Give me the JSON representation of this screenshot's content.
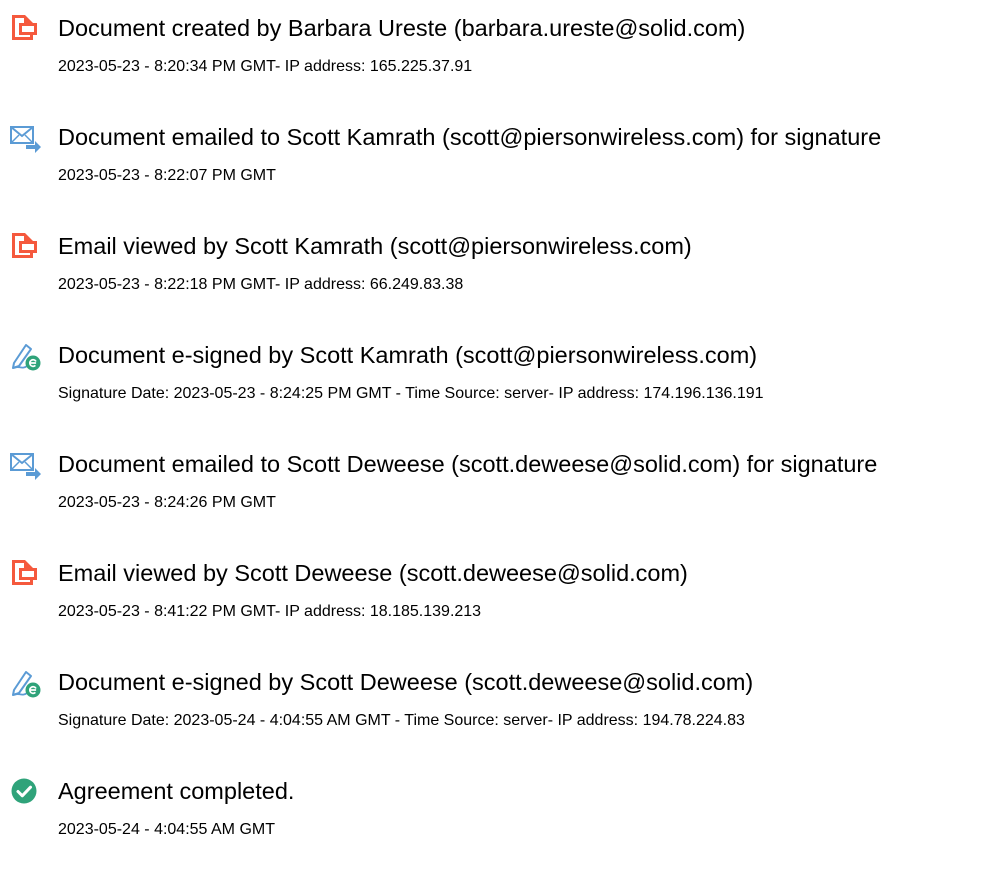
{
  "colors": {
    "document_icon": "#F5593D",
    "email_icon": "#5B9BD5",
    "esign_icon": "#2FA37A",
    "complete_icon": "#2FA37A"
  },
  "events": [
    {
      "icon": "document-icon",
      "title": "Document created by Barbara Ureste (barbara.ureste@solid.com)",
      "detail": "2023-05-23 - 8:20:34 PM GMT- IP address: 165.225.37.91"
    },
    {
      "icon": "email-sent-icon",
      "title": "Document emailed to Scott Kamrath (scott@piersonwireless.com) for signature",
      "detail": "2023-05-23 - 8:22:07 PM GMT"
    },
    {
      "icon": "document-icon",
      "title": "Email viewed by Scott Kamrath (scott@piersonwireless.com)",
      "detail": "2023-05-23 - 8:22:18 PM GMT- IP address: 66.249.83.38"
    },
    {
      "icon": "esign-pen-icon",
      "title": "Document e-signed by Scott Kamrath (scott@piersonwireless.com)",
      "detail": "Signature Date: 2023-05-23 - 8:24:25 PM GMT - Time Source: server- IP address: 174.196.136.191"
    },
    {
      "icon": "email-sent-icon",
      "title": "Document emailed to Scott Deweese (scott.deweese@solid.com) for signature",
      "detail": "2023-05-23 - 8:24:26 PM GMT"
    },
    {
      "icon": "document-icon",
      "title": "Email viewed by Scott Deweese (scott.deweese@solid.com)",
      "detail": "2023-05-23 - 8:41:22 PM GMT- IP address: 18.185.139.213"
    },
    {
      "icon": "esign-pen-icon",
      "title": "Document e-signed by Scott Deweese (scott.deweese@solid.com)",
      "detail": "Signature Date: 2023-05-24 - 4:04:55 AM GMT - Time Source: server- IP address: 194.78.224.83"
    },
    {
      "icon": "checkmark-circle-icon",
      "title": "Agreement completed.",
      "detail": "2023-05-24 - 4:04:55 AM GMT"
    }
  ]
}
